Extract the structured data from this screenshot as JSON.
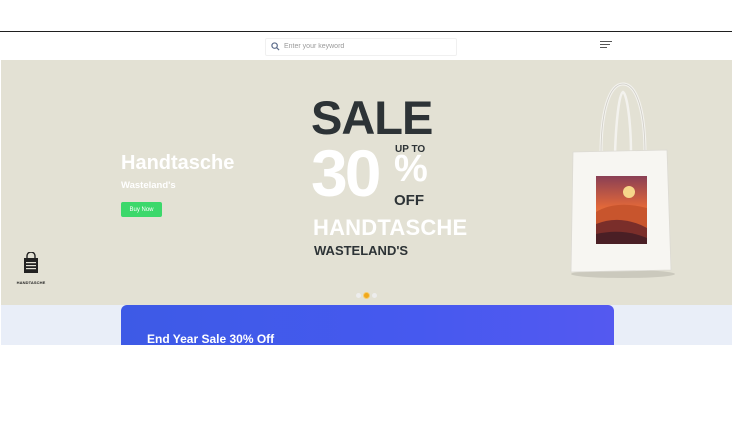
{
  "header": {
    "search_placeholder": "Enter your keyword"
  },
  "hero": {
    "title": "Handtasche",
    "subtitle": "Wasteland's",
    "button_label": "Buy Now",
    "logo_text": "HANDTASCHE",
    "promo": {
      "sale": "SALE",
      "up_to": "UP TO",
      "amount": "30",
      "percent": "%",
      "off": "OFF",
      "brand": "HANDTASCHE",
      "store": "WASTELAND'S"
    },
    "carousel": {
      "slides": 3,
      "active_index": 1
    }
  },
  "promo_card": {
    "title": "End Year Sale 30% Off"
  },
  "colors": {
    "hero_bg": "#e3e1d4",
    "buy_button": "#3cd86b",
    "promo_card": "#4659ef",
    "dot_active": "#f0a81c"
  },
  "icons": [
    "search-icon",
    "hamburger-menu-icon",
    "shopping-bag-logo-icon"
  ]
}
